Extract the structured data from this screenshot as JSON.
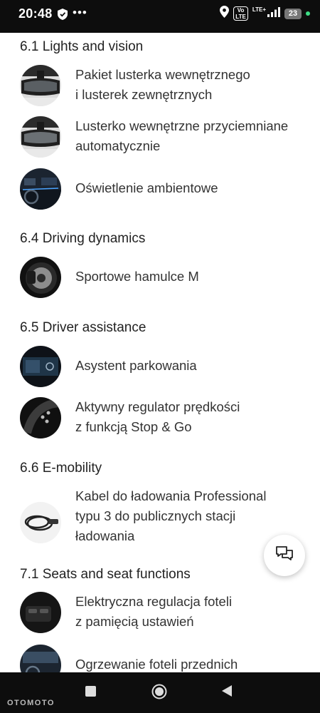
{
  "status_bar": {
    "time": "20:48",
    "volte": "Vo\nLTE",
    "lte": "LTE+",
    "battery": "23",
    "icons": [
      "shield-icon",
      "more-dots-icon",
      "location-icon",
      "signal-icon",
      "battery-icon"
    ]
  },
  "sections": [
    {
      "title": "6.1 Lights and vision",
      "items": [
        {
          "lines": [
            "Pakiet lusterka wewnętrznego",
            "i lusterek zewnętrznych"
          ],
          "icon": "rearview-mirror-thumb"
        },
        {
          "lines": [
            "Lusterko wewnętrzne przyciemniane",
            "automatycznie"
          ],
          "icon": "rearview-mirror-thumb"
        },
        {
          "lines": [
            "Oświetlenie ambientowe"
          ],
          "icon": "car-interior-thumb"
        }
      ]
    },
    {
      "title": "6.4 Driving dynamics",
      "items": [
        {
          "lines": [
            "Sportowe hamulce M"
          ],
          "icon": "brake-thumb"
        }
      ]
    },
    {
      "title": "6.5 Driver assistance",
      "items": [
        {
          "lines": [
            "Asystent parkowania"
          ],
          "icon": "display-thumb"
        },
        {
          "lines": [
            "Aktywny regulator prędkości",
            "z funkcją Stop & Go"
          ],
          "icon": "steering-wheel-thumb"
        }
      ]
    },
    {
      "title": "6.6 E-mobility",
      "items": [
        {
          "lines": [
            "Kabel do ładowania Professional",
            "typu 3 do publicznych stacji",
            "ładowania"
          ],
          "icon": "charging-cable-thumb"
        }
      ]
    },
    {
      "title": "7.1 Seats and seat functions",
      "items": [
        {
          "lines": [
            "Elektryczna regulacja foteli",
            "z pamięcią ustawień"
          ],
          "icon": "seat-controls-thumb"
        },
        {
          "lines": [
            "Ogrzewanie foteli przednich"
          ],
          "icon": "dashboard-thumb"
        }
      ]
    }
  ],
  "chat_button": {
    "icon": "chat-icon"
  },
  "nav_bar": {
    "brand": "OTOMOTO",
    "icons": [
      "recents-icon",
      "home-icon",
      "back-icon"
    ]
  }
}
